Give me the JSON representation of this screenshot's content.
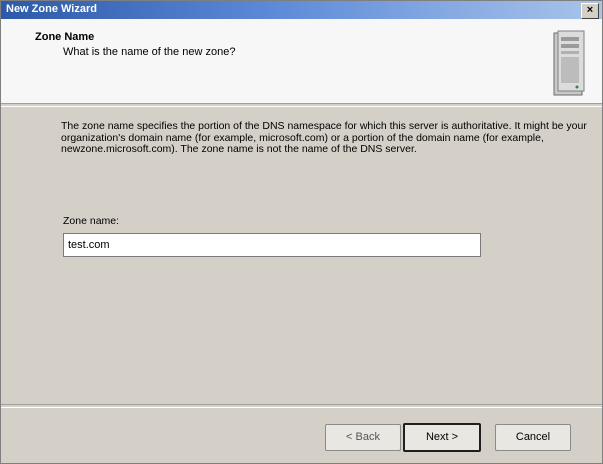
{
  "window": {
    "title": "New Zone Wizard",
    "close_glyph": "×"
  },
  "header": {
    "title": "Zone Name",
    "subtitle": "What is the name of the new zone?",
    "icon": "server-icon"
  },
  "body": {
    "description": "The zone name specifies the portion of the DNS namespace for which this server is authoritative. It might be your organization's domain name (for example, microsoft.com) or a portion of the domain name (for example, newzone.microsoft.com). The zone name is not the name of the DNS server.",
    "zone_name_label": "Zone name:",
    "zone_name_value": "test.com"
  },
  "buttons": {
    "back": "< Back",
    "next": "Next >",
    "cancel": "Cancel"
  }
}
